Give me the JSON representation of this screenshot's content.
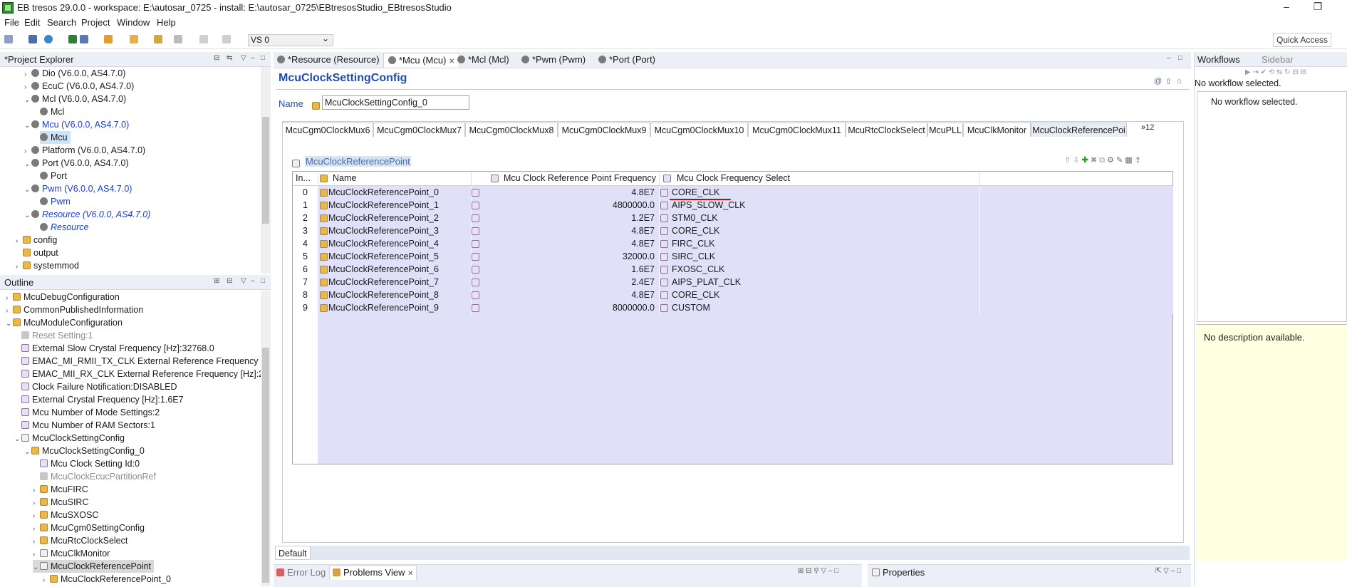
{
  "window": {
    "title": "EB tresos 29.0.0 - workspace: E:\\autosar_0725 - install: E:\\autosar_0725\\EBtresosStudio_EBtresosStudio",
    "minimize": "–",
    "restore": "❐"
  },
  "menu": [
    "File",
    "Edit",
    "Search",
    "Project",
    "Window",
    "Help"
  ],
  "toolbar": {
    "vs_select": "VS 0",
    "quick_access": "Quick Access"
  },
  "project_explorer": {
    "title": "*Project Explorer",
    "items": [
      {
        "label": "Dio (V6.0.0, AS4.7.0)"
      },
      {
        "label": "EcuC (V6.0.0, AS4.7.0)"
      },
      {
        "label": "Mcl (V6.0.0, AS4.7.0)"
      },
      {
        "label": "Mcl"
      },
      {
        "label": "Mcu (V6.0.0, AS4.7.0)"
      },
      {
        "label": "Mcu"
      },
      {
        "label": "Platform (V6.0.0, AS4.7.0)"
      },
      {
        "label": "Port (V6.0.0, AS4.7.0)"
      },
      {
        "label": "Port"
      },
      {
        "label": "Pwm (V6.0.0, AS4.7.0)"
      },
      {
        "label": "Pwm"
      },
      {
        "label": "Resource (V6.0.0, AS4.7.0)"
      },
      {
        "label": "Resource"
      },
      {
        "label": "config"
      },
      {
        "label": "output"
      },
      {
        "label": "systemmod"
      }
    ]
  },
  "outline": {
    "title": "Outline",
    "items": [
      {
        "label": "McuDebugConfiguration"
      },
      {
        "label": "CommonPublishedInformation"
      },
      {
        "label": "McuModuleConfiguration"
      },
      {
        "label": "Reset Setting:1"
      },
      {
        "label": "External Slow Crystal Frequency [Hz]:32768.0"
      },
      {
        "label": "EMAC_MI_RMII_TX_CLK External Reference Frequency [I"
      },
      {
        "label": "EMAC_MII_RX_CLK External Reference Frequency [Hz]:2"
      },
      {
        "label": "Clock Failure Notification:DISABLED"
      },
      {
        "label": "External Crystal Frequency [Hz]:1.6E7"
      },
      {
        "label": "Mcu Number of Mode Settings:2"
      },
      {
        "label": "Mcu Number of RAM Sectors:1"
      },
      {
        "label": "McuClockSettingConfig"
      },
      {
        "label": "McuClockSettingConfig_0"
      },
      {
        "label": "Mcu Clock Setting Id:0"
      },
      {
        "label": "McuClockEcucPartitionRef"
      },
      {
        "label": "McuFIRC"
      },
      {
        "label": "McuSIRC"
      },
      {
        "label": "McuSXOSC"
      },
      {
        "label": "McuCgm0SettingConfig"
      },
      {
        "label": "McuRtcClockSelect"
      },
      {
        "label": "McuClkMonitor"
      },
      {
        "label": "McuClockReferencePoint"
      },
      {
        "label": "McuClockReferencePoint_0"
      }
    ]
  },
  "editor_tabs": [
    {
      "label": "*Resource (Resource)"
    },
    {
      "label": "*Mcu (Mcu)"
    },
    {
      "label": "*Mcl (Mcl)"
    },
    {
      "label": "*Pwm (Pwm)"
    },
    {
      "label": "*Port (Port)"
    }
  ],
  "editor": {
    "heading": "McuClockSettingConfig",
    "name_label": "Name",
    "name_value": "McuClockSettingConfig_0",
    "sub_tabs": [
      "McuCgm0ClockMux6",
      "McuCgm0ClockMux7",
      "McuCgm0ClockMux8",
      "McuCgm0ClockMux9",
      "McuCgm0ClockMux10",
      "McuCgm0ClockMux11",
      "McuRtcClockSelect",
      "McuPLL",
      "McuClkMonitor",
      "McuClockReferencePoi"
    ],
    "sub_tabs_overflow": "»12",
    "section_title": "McuClockReferencePoint",
    "columns": {
      "index": "In...",
      "name": "Name",
      "freq": "Mcu Clock Reference Point Frequency",
      "select": "Mcu Clock Frequency Select"
    },
    "rows": [
      {
        "index": "0",
        "name": "McuClockReferencePoint_0",
        "freq": "4.8E7",
        "select": "CORE_CLK"
      },
      {
        "index": "1",
        "name": "McuClockReferencePoint_1",
        "freq": "4800000.0",
        "select": "AIPS_SLOW_CLK"
      },
      {
        "index": "2",
        "name": "McuClockReferencePoint_2",
        "freq": "1.2E7",
        "select": "STM0_CLK"
      },
      {
        "index": "3",
        "name": "McuClockReferencePoint_3",
        "freq": "4.8E7",
        "select": "CORE_CLK"
      },
      {
        "index": "4",
        "name": "McuClockReferencePoint_4",
        "freq": "4.8E7",
        "select": "FIRC_CLK"
      },
      {
        "index": "5",
        "name": "McuClockReferencePoint_5",
        "freq": "32000.0",
        "select": "SIRC_CLK"
      },
      {
        "index": "6",
        "name": "McuClockReferencePoint_6",
        "freq": "1.6E7",
        "select": "FXOSC_CLK"
      },
      {
        "index": "7",
        "name": "McuClockReferencePoint_7",
        "freq": "2.4E7",
        "select": "AIPS_PLAT_CLK"
      },
      {
        "index": "8",
        "name": "McuClockReferencePoint_8",
        "freq": "4.8E7",
        "select": "CORE_CLK"
      },
      {
        "index": "9",
        "name": "McuClockReferencePoint_9",
        "freq": "8000000.0",
        "select": "CUSTOM"
      }
    ],
    "bottom_tab": "Default"
  },
  "workflows": {
    "title": "Workflows",
    "sidebar": "Sidebar",
    "status": "No workflow selected.",
    "inner": "No workflow selected.",
    "description": "No description available."
  },
  "bottom_views": {
    "error_log": "Error Log",
    "problems": "Problems View",
    "properties": "Properties"
  },
  "colors": {
    "accent_link": "#1a3dd6",
    "row_highlight": "#e0e0f8",
    "annotation_red": "#e00000"
  }
}
